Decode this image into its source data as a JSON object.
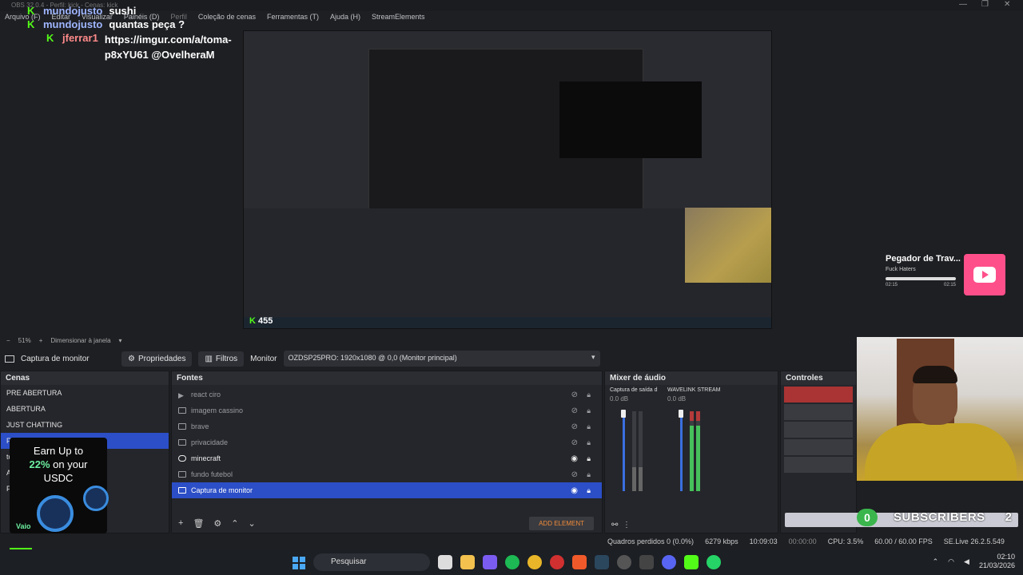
{
  "window": {
    "title": "OBS 32.0.4 - Perfil: kick - Cenas: kick"
  },
  "menu": [
    "Arquivo (F)",
    "Editar",
    "Visualizar",
    "Painéis (D)",
    "Perfil",
    "Coleção de cenas",
    "Ferramentas (T)",
    "Ajuda (H)",
    "StreamElements"
  ],
  "chat": [
    {
      "user": "mundojusto",
      "msg": "sushi",
      "user_color": "#9fb6ff"
    },
    {
      "user": "mundojusto",
      "msg": "quantas peça ?",
      "user_color": "#9fb6ff"
    },
    {
      "user": "jferrar1",
      "msg": "https://imgur.com/a/toma-p8xYU61 @OvelheraM",
      "user_color": "#ff8a8a"
    }
  ],
  "media": {
    "title": "Pegador de Trav...",
    "artist": "Fuck Haters",
    "time_elapsed": "02:15",
    "time_total": "02:15",
    "progress": 1.0
  },
  "zoom": {
    "level": "51%",
    "plus": "+",
    "minus": "−",
    "fit_label": "Dimensionar à janela"
  },
  "source_bar": {
    "source_name": "Captura de monitor",
    "properties": "Propriedades",
    "filters": "Filtros",
    "monitor_label": "Monitor",
    "monitor_value": "OZDSP25PRO: 1920x1080 @ 0,0 (Monitor principal)"
  },
  "scenes": {
    "title": "Cenas",
    "items": [
      "PRE ABERTURA",
      "ABERTURA",
      "JUST CHATTING",
      "P",
      "to",
      "A",
      "P"
    ],
    "selected_index": 3
  },
  "sources": {
    "title": "Fontes",
    "items": [
      {
        "name": "react ciro",
        "visible": false
      },
      {
        "name": "imagem cassino",
        "visible": false
      },
      {
        "name": "brave",
        "visible": false
      },
      {
        "name": "privacidade",
        "visible": false
      },
      {
        "name": "minecraft",
        "visible": true
      },
      {
        "name": "fundo futebol",
        "visible": false
      },
      {
        "name": "Captura de monitor",
        "visible": true
      }
    ],
    "selected_index": 6,
    "add_element": "ADD ELEMENT"
  },
  "mixer": {
    "title": "Mixer de áudio",
    "channels": [
      {
        "name": "Captura de saída d",
        "db": "0.0 dB"
      },
      {
        "name": "WAVELINK STREAM",
        "db": "0.0 dB"
      }
    ],
    "scale": [
      "0",
      "-5",
      "-10",
      "-15",
      "-20",
      "-25",
      "-30",
      "-35",
      "-40",
      "-45",
      "-50",
      "-55",
      "-60"
    ]
  },
  "controls": {
    "title": "Controles"
  },
  "subscribers": {
    "count_left": "0",
    "label": "SUBSCRIBERS",
    "count_right": "2"
  },
  "ad": {
    "line1": "Earn Up to",
    "highlight": "22%",
    "line2": "on your",
    "line3": "USDC",
    "brand": "Vaio"
  },
  "kick": {
    "viewers": "455"
  },
  "status": {
    "dropped": "Quadros perdidos 0 (0.0%)",
    "bitrate": "6279 kbps",
    "stream_time": "10:09:03",
    "rec_time": "00:00:00",
    "cpu": "CPU: 3.5%",
    "fps": "60.00 / 60.00 FPS",
    "version": "SE.Live 26.2.5.549"
  },
  "taskbar": {
    "search": "Pesquisar",
    "time": "02:10",
    "date": "21/03/2026"
  }
}
